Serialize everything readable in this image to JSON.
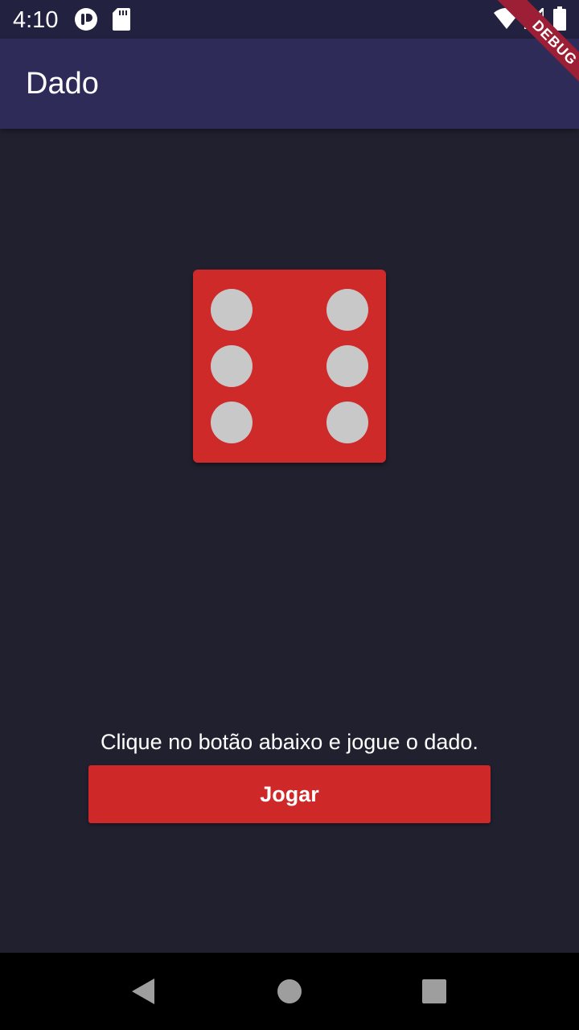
{
  "status_bar": {
    "time": "4:10",
    "icons": [
      "accessibility-icon",
      "sd-card-icon",
      "wifi-icon",
      "signal-icon",
      "battery-icon"
    ]
  },
  "debug_banner": {
    "label": "DEBUG"
  },
  "app_bar": {
    "title": "Dado"
  },
  "die": {
    "face_value": 6,
    "face_color": "#cf2a2a",
    "pip_color": "#c8c8c8"
  },
  "main": {
    "instruction": "Clique no botão abaixo e jogue o dado.",
    "play_button_label": "Jogar",
    "play_button_color": "#cf2828"
  },
  "nav_bar": {
    "icons": [
      "back-icon",
      "home-icon",
      "recents-icon"
    ]
  },
  "colors": {
    "background": "#21202f",
    "app_bar": "#2e2b58",
    "status_bar": "#232140"
  }
}
